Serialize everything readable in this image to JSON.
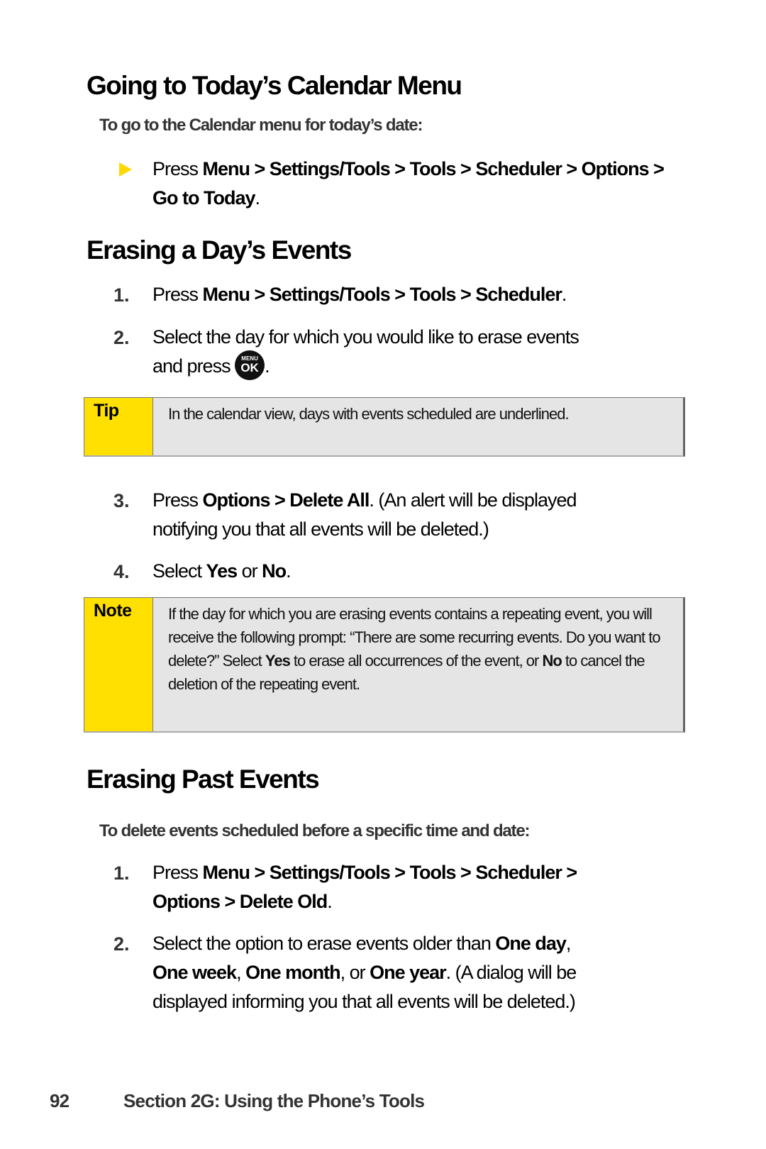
{
  "sections": [
    {
      "title": "Going to Today’s Calendar Menu",
      "intro": "To go to the Calendar menu for today’s date:",
      "bullet": {
        "prefix": "Press ",
        "path": "Menu > Settings/Tools > Tools > Scheduler > Options >",
        "path2": "Go to Today",
        "suffix": "."
      }
    },
    {
      "title": "Erasing a Day’s Events",
      "steps": [
        {
          "num": "1.",
          "prefix": "Press ",
          "bold": "Menu > Settings/Tools > Tools > Scheduler",
          "suffix": "."
        },
        {
          "num": "2.",
          "line1": "Select the day for which you would like to erase events",
          "line2_prefix": "and press ",
          "line2_suffix": "."
        },
        {
          "num": "3.",
          "prefix": "Press ",
          "bold": "Options > Delete All",
          "suffix": ". (An alert will be displayed",
          "line2": "notifying you that all events will be deleted.)"
        },
        {
          "num": "4.",
          "prefix": "Select ",
          "bold1": "Yes",
          "middle": " or ",
          "bold2": "No",
          "suffix": "."
        }
      ],
      "tip": {
        "label": "Tip",
        "text": "In the calendar view, days with events scheduled are underlined."
      },
      "note": {
        "label": "Note",
        "text_a": "If the day for which you are erasing events contains a repeating event, you will receive the following prompt: “There are some recurring events. Do you want to delete?” Select ",
        "bold_yes": "Yes",
        "text_b": " to erase all occurrences of the event, or ",
        "bold_no": "No",
        "text_c": " to cancel the deletion of the repeating event."
      }
    },
    {
      "title": "Erasing Past Events",
      "intro": "To delete events scheduled before a specific time and date:",
      "steps": [
        {
          "num": "1.",
          "prefix": "Press ",
          "bold": "Menu > Settings/Tools > Tools > Scheduler >",
          "bold2": "Options > Delete Old",
          "suffix": "."
        },
        {
          "num": "2.",
          "text1": "Select the option to erase events older than ",
          "b1": "One day",
          "t2": ",",
          "b2": "One week",
          "t3": ", ",
          "b3": "One month",
          "t4": ", or ",
          "b4": "One year",
          "t5": ". (A dialog will be",
          "line3": "displayed informing you that all events will be deleted.)"
        }
      ]
    }
  ],
  "ok_key": {
    "top": "MENU",
    "bottom": "OK",
    "icon": "menu-ok-key-icon"
  },
  "footer": {
    "page_number": "92",
    "section": "Section 2G: Using the Phone’s Tools"
  },
  "colors": {
    "callout_label": "#ffe000",
    "callout_body": "#e5e5e5",
    "bullet_arrow": "#ffd800"
  }
}
